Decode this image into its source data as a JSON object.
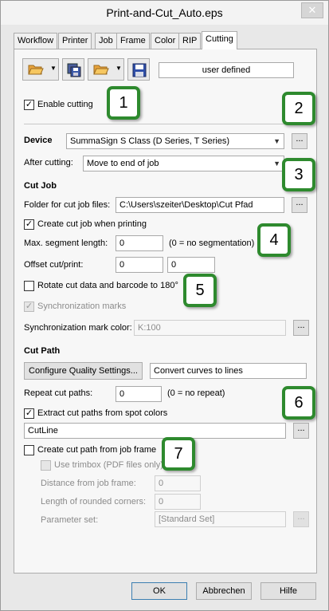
{
  "window": {
    "title": "Print-and-Cut_Auto.eps",
    "close_label": "✕"
  },
  "tabs": [
    "Workflow",
    "Printer",
    "Job",
    "Frame",
    "Color",
    "RIP",
    "Cutting"
  ],
  "toolbar": {
    "preset_value": "user defined"
  },
  "enable_cutting": {
    "label": "Enable cutting",
    "checked": true
  },
  "device": {
    "label": "Device",
    "value": "SummaSign S Class (D Series, T Series)",
    "after_cutting_label": "After cutting:",
    "after_cutting_value": "Move to end of job"
  },
  "cut_job": {
    "heading": "Cut Job",
    "folder_label": "Folder for cut job files:",
    "folder_value": "C:\\Users\\szeiter\\Desktop\\Cut Pfad",
    "create_label": "Create cut job when printing",
    "max_seg_label": "Max. segment length:",
    "max_seg_value": "0",
    "max_seg_hint": "(0 = no segmentation)",
    "offset_label": "Offset cut/print:",
    "offset_x": "0",
    "offset_y": "0",
    "rotate_label": "Rotate cut data and barcode to 180°",
    "sync_marks_label": "Synchronization marks",
    "sync_color_label": "Synchronization mark color:",
    "sync_color_value": "K:100"
  },
  "cut_path": {
    "heading": "Cut Path",
    "configure_label": "Configure Quality Settings...",
    "convert_value": "Convert curves to lines",
    "repeat_label": "Repeat cut paths:",
    "repeat_value": "0",
    "repeat_hint": "(0 = no repeat)",
    "extract_label": "Extract cut paths from spot colors",
    "spot_value": "CutLine",
    "frame_label": "Create cut path from job frame",
    "trimbox_label": "Use trimbox (PDF files only)",
    "distance_label": "Distance from job frame:",
    "distance_value": "0",
    "rounded_label": "Length of rounded corners:",
    "rounded_value": "0",
    "param_label": "Parameter set:",
    "param_value": "[Standard Set]"
  },
  "callouts": [
    "1",
    "2",
    "3",
    "4",
    "5",
    "6",
    "7"
  ],
  "footer": {
    "ok": "OK",
    "cancel": "Abbrechen",
    "help": "Hilfe"
  },
  "colors": {
    "callout_border": "#2e8a2e",
    "panel_bg": "#f7f7f7"
  },
  "browse_label": "..."
}
